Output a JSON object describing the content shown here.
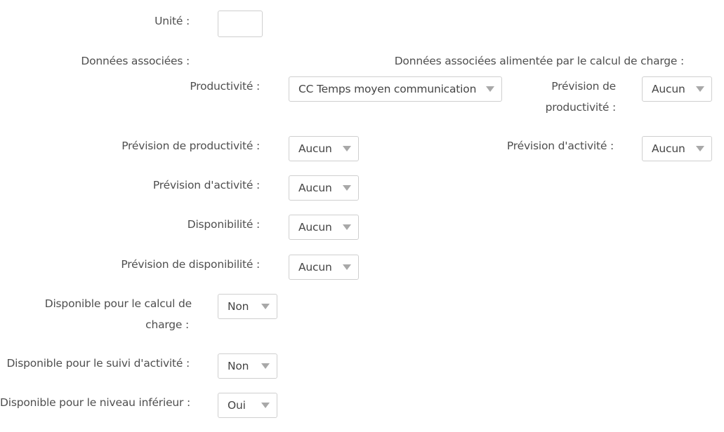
{
  "form": {
    "unite_label": "Unité :",
    "unite_value": "",
    "donnees_associees_label": "Données associées :",
    "donnees_alimentees_label": "Données associées alimentée par le calcul de charge :",
    "left": {
      "productivite": {
        "label": "Productivité :",
        "value": "CC Temps moyen communication"
      },
      "prevision_productivite": {
        "label": "Prévision de productivité :",
        "value": "Aucun"
      },
      "prevision_activite": {
        "label": "Prévision d'activité :",
        "value": "Aucun"
      },
      "disponibilite": {
        "label": "Disponibilité :",
        "value": "Aucun"
      },
      "prevision_disponibilite": {
        "label": "Prévision de disponibilité :",
        "value": "Aucun"
      }
    },
    "right": {
      "prevision_productivite": {
        "label_line1": "Prévision de",
        "label_line2": "productivité :",
        "value": "Aucun"
      },
      "prevision_activite": {
        "label": "Prévision d'activité :",
        "value": "Aucun"
      }
    },
    "calcul_charge": {
      "label_line1": "Disponible pour le calcul de",
      "label_line2": "charge :",
      "value": "Non"
    },
    "suivi_activite": {
      "label": "Disponible pour le suivi d'activité :",
      "value": "Non"
    },
    "niveau_inferieur": {
      "label": "Disponible pour le niveau inférieur :",
      "value": "Oui"
    }
  }
}
